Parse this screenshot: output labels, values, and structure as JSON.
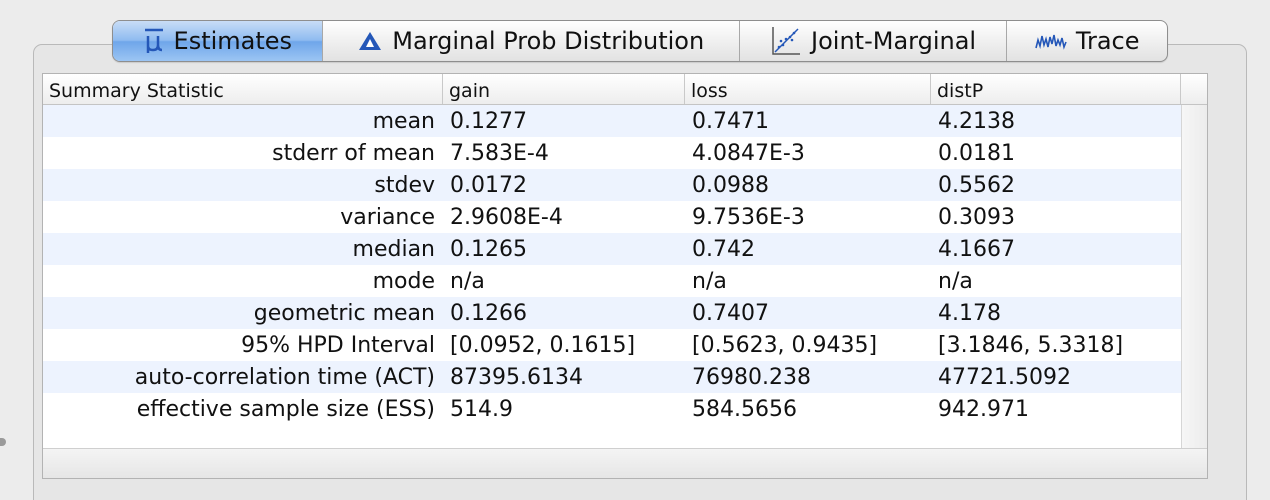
{
  "tabs": [
    {
      "label": "Estimates",
      "icon": "mu-icon",
      "selected": true
    },
    {
      "label": "Marginal Prob Distribution",
      "icon": "triangle-icon",
      "selected": false
    },
    {
      "label": "Joint-Marginal",
      "icon": "scatter-icon",
      "selected": false
    },
    {
      "label": "Trace",
      "icon": "trace-icon",
      "selected": false
    }
  ],
  "table": {
    "headers": [
      "Summary Statistic",
      "gain",
      "loss",
      "distP"
    ],
    "rows": [
      [
        "mean",
        "0.1277",
        "0.7471",
        "4.2138"
      ],
      [
        "stderr of mean",
        "7.583E-4",
        "4.0847E-3",
        "0.0181"
      ],
      [
        "stdev",
        "0.0172",
        "0.0988",
        "0.5562"
      ],
      [
        "variance",
        "2.9608E-4",
        "9.7536E-3",
        "0.3093"
      ],
      [
        "median",
        "0.1265",
        "0.742",
        "4.1667"
      ],
      [
        "mode",
        "n/a",
        "n/a",
        "n/a"
      ],
      [
        "geometric mean",
        "0.1266",
        "0.7407",
        "4.178"
      ],
      [
        "95% HPD Interval",
        "[0.0952, 0.1615]",
        "[0.5623, 0.9435]",
        "[3.1846, 5.3318]"
      ],
      [
        "auto-correlation time (ACT)",
        "87395.6134",
        "76980.238",
        "47721.5092"
      ],
      [
        "effective sample size (ESS)",
        "514.9",
        "584.5656",
        "942.971"
      ]
    ]
  },
  "colors": {
    "selected_tab": "#8fbbf0",
    "row_stripe": "#edf3fe",
    "icon_blue": "#2457b8"
  }
}
